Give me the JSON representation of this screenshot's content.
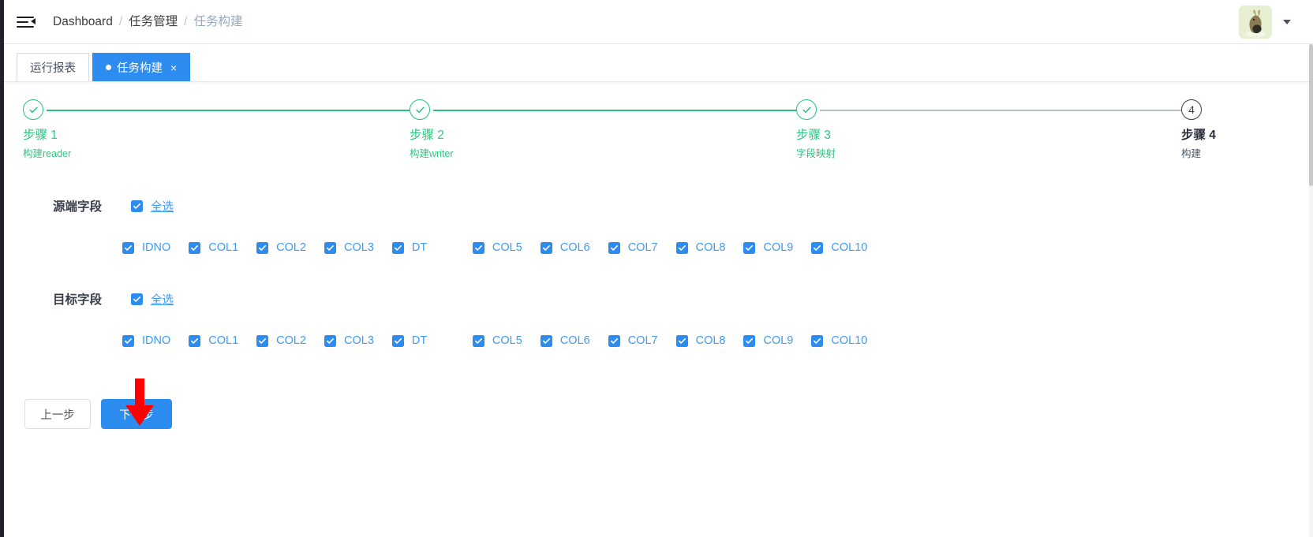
{
  "header": {
    "menu_icon": "collapse-menu-icon",
    "breadcrumb": [
      {
        "label": "Dashboard",
        "muted": false
      },
      {
        "label": "任务管理",
        "muted": false
      },
      {
        "label": "任务构建",
        "muted": true
      }
    ],
    "separator": "/",
    "avatar_alt": "user-avatar",
    "caret": "chevron-down-icon"
  },
  "tabs": [
    {
      "label": "运行报表",
      "active": false,
      "closable": false
    },
    {
      "label": "任务构建",
      "active": true,
      "closable": true,
      "close_label": "×"
    }
  ],
  "steps": [
    {
      "index": "1",
      "title": "步骤 1",
      "desc": "构建reader",
      "status": "finish"
    },
    {
      "index": "2",
      "title": "步骤 2",
      "desc": "构建writer",
      "status": "finish"
    },
    {
      "index": "3",
      "title": "步骤 3",
      "desc": "字段映射",
      "status": "finish"
    },
    {
      "index": "4",
      "title": "步骤 4",
      "desc": "构建",
      "status": "pending"
    }
  ],
  "source_section": {
    "label": "源端字段",
    "select_all_label": "全选",
    "select_all_checked": true,
    "fields": [
      {
        "name": "IDNO",
        "checked": true
      },
      {
        "name": "COL1",
        "checked": true
      },
      {
        "name": "COL2",
        "checked": true
      },
      {
        "name": "COL3",
        "checked": true
      },
      {
        "name": "DT",
        "checked": true
      },
      {
        "name": "COL5",
        "checked": true
      },
      {
        "name": "COL6",
        "checked": true
      },
      {
        "name": "COL7",
        "checked": true
      },
      {
        "name": "COL8",
        "checked": true
      },
      {
        "name": "COL9",
        "checked": true
      },
      {
        "name": "COL10",
        "checked": true
      }
    ]
  },
  "target_section": {
    "label": "目标字段",
    "select_all_label": "全选",
    "select_all_checked": true,
    "fields": [
      {
        "name": "IDNO",
        "checked": true
      },
      {
        "name": "COL1",
        "checked": true
      },
      {
        "name": "COL2",
        "checked": true
      },
      {
        "name": "COL3",
        "checked": true
      },
      {
        "name": "DT",
        "checked": true
      },
      {
        "name": "COL5",
        "checked": true
      },
      {
        "name": "COL6",
        "checked": true
      },
      {
        "name": "COL7",
        "checked": true
      },
      {
        "name": "COL8",
        "checked": true
      },
      {
        "name": "COL9",
        "checked": true
      },
      {
        "name": "COL10",
        "checked": true
      }
    ]
  },
  "footer": {
    "prev_label": "上一步",
    "next_label": "下一步"
  },
  "annotation": {
    "arrow": "red-down-arrow",
    "color": "#fe0000"
  },
  "colors": {
    "primary": "#2d8cf0",
    "success": "#26c281",
    "link": "#3e9bf5",
    "pending": "#3c4150",
    "line_grey": "#b9bfcc"
  }
}
